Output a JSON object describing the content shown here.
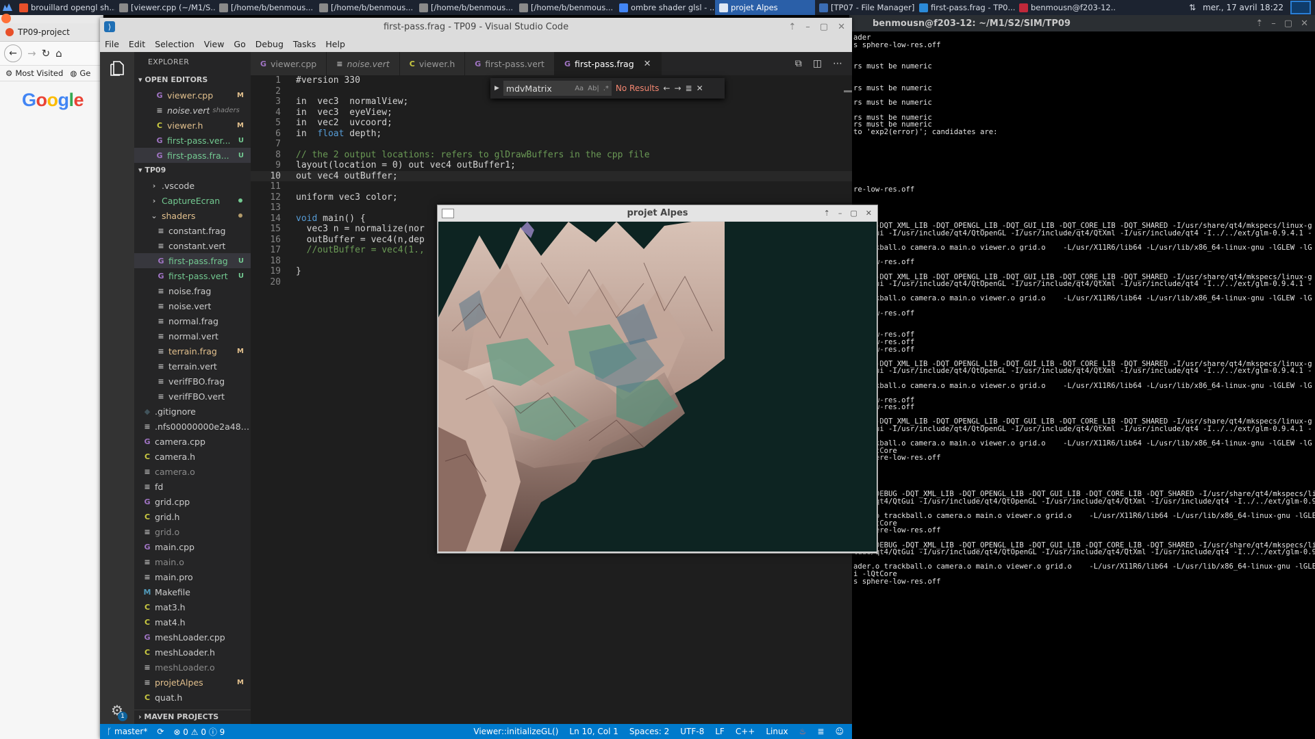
{
  "taskbar": {
    "tasks": [
      {
        "label": "brouillard opengl sh...",
        "icon": "firefox-icon",
        "color": "#e8502a"
      },
      {
        "label": "[viewer.cpp (~/M1/S...",
        "icon": "editor-icon",
        "color": "#8a8a8a"
      },
      {
        "label": "[/home/b/benmous...",
        "icon": "editor-icon",
        "color": "#8a8a8a"
      },
      {
        "label": "[/home/b/benmous...",
        "icon": "editor-icon",
        "color": "#8a8a8a"
      },
      {
        "label": "[/home/b/benmous...",
        "icon": "editor-icon",
        "color": "#8a8a8a"
      },
      {
        "label": "[/home/b/benmous...",
        "icon": "editor-icon",
        "color": "#8a8a8a"
      },
      {
        "label": "ombre shader glsl - ...",
        "icon": "chrome-icon",
        "color": "#4285f4"
      },
      {
        "label": "projet Alpes",
        "icon": "window-icon",
        "color": "#dfe8f5",
        "active": true
      },
      {
        "label": "[TP07 - File Manager]",
        "icon": "folder-icon",
        "color": "#3b6db5"
      },
      {
        "label": "first-pass.frag - TP0...",
        "icon": "vscode-icon",
        "color": "#2b8ad8"
      },
      {
        "label": "benmousn@f203-12...",
        "icon": "terminal-icon",
        "color": "#c0283a"
      }
    ],
    "clock": "mer., 17 avril 18:22"
  },
  "firefox": {
    "tab_title": "TP09-project",
    "bookmark": "Most Visited",
    "bookmark2": "Ge",
    "logo_text": "Google"
  },
  "terminal": {
    "title": "benmousn@f203-12: ~/M1/S2/SIM/TP09",
    "lines": [
      "ader",
      "s sphere-low-res.off",
      "",
      "",
      "rs must be numeric",
      "",
      "",
      "rs must be numeric",
      "",
      "rs must be numeric",
      "",
      "rs must be numeric",
      "rs must be numeric",
      "to 'exp2(error)'; candidates are:",
      "",
      "",
      "",
      "",
      "",
      "",
      "",
      "re-low-res.off",
      "",
      "",
      "",
      "",
      "EBUG -DQT_XML_LIB -DQT_OPENGL_LIB -DQT_GUI_LIB -DQT_CORE_LIB -DQT_SHARED -I/usr/share/qt4/mkspecs/linux-g",
      "4/QtGui -I/usr/include/qt4/QtOpenGL -I/usr/include/qt4/QtXml -I/usr/include/qt4 -I../../ext/glm-0.9.4.1 -",
      "",
      " trackball.o camera.o main.o viewer.o grid.o    -L/usr/X11R6/lib64 -L/usr/lib/x86_64-linux-gnu -lGLEW -lG",
      "Core",
      "re-low-res.off",
      "",
      "EBUG -DQT_XML_LIB -DQT_OPENGL_LIB -DQT_GUI_LIB -DQT_CORE_LIB -DQT_SHARED -I/usr/share/qt4/mkspecs/linux-g",
      "4/QtGui -I/usr/include/qt4/QtOpenGL -I/usr/include/qt4/QtXml -I/usr/include/qt4 -I../../ext/glm-0.9.4.1 -",
      "",
      " trackball.o camera.o main.o viewer.o grid.o    -L/usr/X11R6/lib64 -L/usr/lib/x86_64-linux-gnu -lGLEW -lG",
      "Core",
      "re-low-res.off",
      "",
      "",
      "re-low-res.off",
      "re-low-res.off",
      "re-low-res.off",
      "",
      "EBUG -DQT_XML_LIB -DQT_OPENGL_LIB -DQT_GUI_LIB -DQT_CORE_LIB -DQT_SHARED -I/usr/share/qt4/mkspecs/linux-g",
      "4/QtGui -I/usr/include/qt4/QtOpenGL -I/usr/include/qt4/QtXml -I/usr/include/qt4 -I../../ext/glm-0.9.4.1 -",
      "",
      " trackball.o camera.o main.o viewer.o grid.o    -L/usr/X11R6/lib64 -L/usr/lib/x86_64-linux-gnu -lGLEW -lG",
      "Core",
      "re-low-res.off",
      "re-low-res.off",
      "",
      "EBUG -DQT_XML_LIB -DQT_OPENGL_LIB -DQT_GUI_LIB -DQT_CORE_LIB -DQT_SHARED -I/usr/share/qt4/mkspecs/linux-g",
      "4/QtGui -I/usr/include/qt4/QtOpenGL -I/usr/include/qt4/QtXml -I/usr/include/qt4 -I../../ext/glm-0.9.4.1 -",
      "",
      " trackball.o camera.o main.o viewer.o grid.o    -L/usr/X11R6/lib64 -L/usr/lib/x86_64-linux-gnu -lGLEW -lG",
      "i -lQtCore",
      "s sphere-low-res.off",
      "",
      "",
      "",
      "",
      "T_NO_DEBUG -DQT_XML_LIB -DQT_OPENGL_LIB -DQT_GUI_LIB -DQT_CORE_LIB -DQT_SHARED -I/usr/share/qt4/mkspecs/linux-",
      "lude/qt4/QtGui -I/usr/include/qt4/QtOpenGL -I/usr/include/qt4/QtXml -I/usr/include/qt4 -I../../ext/glm-0.9.4.1 -",
      "",
      "ader.o trackball.o camera.o main.o viewer.o grid.o    -L/usr/X11R6/lib64 -L/usr/lib/x86_64-linux-gnu -lGLEW -lG",
      "i -lQtCore",
      "s sphere-low-res.off",
      "",
      "T_NO_DEBUG -DQT_XML_LIB -DQT_OPENGL_LIB -DQT_GUI_LIB -DQT_CORE_LIB -DQT_SHARED -I/usr/share/qt4/mkspecs/linux-",
      "lude/qt4/QtGui -I/usr/include/qt4/QtOpenGL -I/usr/include/qt4/QtXml -I/usr/include/qt4 -I../../ext/glm-0.9.4.1 -",
      "",
      "ader.o trackball.o camera.o main.o viewer.o grid.o    -L/usr/X11R6/lib64 -L/usr/lib/x86_64-linux-gnu -lGLEW -lG",
      "i -lQtCore",
      "s sphere-low-res.off"
    ]
  },
  "vscode": {
    "title": "first-pass.frag - TP09 - Visual Studio Code",
    "menu": [
      "File",
      "Edit",
      "Selection",
      "View",
      "Go",
      "Debug",
      "Tasks",
      "Help"
    ],
    "explorer_label": "EXPLORER",
    "open_editors_label": "OPEN EDITORS",
    "project_label": "TP09",
    "maven_label": "MAVEN PROJECTS",
    "open_editors": [
      {
        "name": "viewer.cpp",
        "icon": "G",
        "icolor": "#a074c4",
        "status": "M",
        "cls": "mod"
      },
      {
        "name": "noise.vert",
        "sub": "shaders",
        "icon": "≡",
        "icolor": "#bbbbbb",
        "italic": true
      },
      {
        "name": "viewer.h",
        "icon": "C",
        "icolor": "#cbcb41",
        "status": "M",
        "cls": "mod"
      },
      {
        "name": "first-pass.ver...",
        "icon": "G",
        "icolor": "#a074c4",
        "status": "U",
        "cls": "unt"
      },
      {
        "name": "first-pass.fra...",
        "icon": "G",
        "icolor": "#a074c4",
        "status": "U",
        "cls": "unt",
        "sel": true
      }
    ],
    "tree": [
      {
        "name": ".vscode",
        "icon": "›",
        "icolor": "#bbbbbb",
        "lvl": 1
      },
      {
        "name": "CaptureEcran",
        "icon": "›",
        "icolor": "#bbbbbb",
        "lvl": 1,
        "cls": "unt",
        "dot": "#73c991"
      },
      {
        "name": "shaders",
        "icon": "⌄",
        "icolor": "#bbbbbb",
        "lvl": 1,
        "cls": "mod",
        "dot": "#b39b6a"
      },
      {
        "name": "constant.frag",
        "icon": "≡",
        "icolor": "#bbbbbb",
        "lvl": 2
      },
      {
        "name": "constant.vert",
        "icon": "≡",
        "icolor": "#bbbbbb",
        "lvl": 2
      },
      {
        "name": "first-pass.frag",
        "icon": "G",
        "icolor": "#a074c4",
        "lvl": 2,
        "cls": "unt",
        "status": "U",
        "sel": true
      },
      {
        "name": "first-pass.vert",
        "icon": "G",
        "icolor": "#a074c4",
        "lvl": 2,
        "cls": "unt",
        "status": "U"
      },
      {
        "name": "noise.frag",
        "icon": "≡",
        "icolor": "#bbbbbb",
        "lvl": 2
      },
      {
        "name": "noise.vert",
        "icon": "≡",
        "icolor": "#bbbbbb",
        "lvl": 2
      },
      {
        "name": "normal.frag",
        "icon": "≡",
        "icolor": "#bbbbbb",
        "lvl": 2
      },
      {
        "name": "normal.vert",
        "icon": "≡",
        "icolor": "#bbbbbb",
        "lvl": 2
      },
      {
        "name": "terrain.frag",
        "icon": "≡",
        "icolor": "#bbbbbb",
        "lvl": 2,
        "cls": "mod",
        "status": "M"
      },
      {
        "name": "terrain.vert",
        "icon": "≡",
        "icolor": "#bbbbbb",
        "lvl": 2
      },
      {
        "name": "verifFBO.frag",
        "icon": "≡",
        "icolor": "#bbbbbb",
        "lvl": 2
      },
      {
        "name": "verifFBO.vert",
        "icon": "≡",
        "icolor": "#bbbbbb",
        "lvl": 2
      },
      {
        "name": ".gitignore",
        "icon": "◆",
        "icolor": "#41535b",
        "lvl": 0
      },
      {
        "name": ".nfs00000000e2a48c...",
        "icon": "≡",
        "icolor": "#bbbbbb",
        "lvl": 0
      },
      {
        "name": "camera.cpp",
        "icon": "G",
        "icolor": "#a074c4",
        "lvl": 0
      },
      {
        "name": "camera.h",
        "icon": "C",
        "icolor": "#cbcb41",
        "lvl": 0
      },
      {
        "name": "camera.o",
        "icon": "≡",
        "icolor": "#bbbbbb",
        "lvl": 0,
        "cls": "dim"
      },
      {
        "name": "fd",
        "icon": "≡",
        "icolor": "#bbbbbb",
        "lvl": 0
      },
      {
        "name": "grid.cpp",
        "icon": "G",
        "icolor": "#a074c4",
        "lvl": 0
      },
      {
        "name": "grid.h",
        "icon": "C",
        "icolor": "#cbcb41",
        "lvl": 0
      },
      {
        "name": "grid.o",
        "icon": "≡",
        "icolor": "#bbbbbb",
        "lvl": 0,
        "cls": "dim"
      },
      {
        "name": "main.cpp",
        "icon": "G",
        "icolor": "#a074c4",
        "lvl": 0
      },
      {
        "name": "main.o",
        "icon": "≡",
        "icolor": "#bbbbbb",
        "lvl": 0,
        "cls": "dim"
      },
      {
        "name": "main.pro",
        "icon": "≡",
        "icolor": "#bbbbbb",
        "lvl": 0
      },
      {
        "name": "Makefile",
        "icon": "M",
        "icolor": "#519aba",
        "lvl": 0
      },
      {
        "name": "mat3.h",
        "icon": "C",
        "icolor": "#cbcb41",
        "lvl": 0
      },
      {
        "name": "mat4.h",
        "icon": "C",
        "icolor": "#cbcb41",
        "lvl": 0
      },
      {
        "name": "meshLoader.cpp",
        "icon": "G",
        "icolor": "#a074c4",
        "lvl": 0
      },
      {
        "name": "meshLoader.h",
        "icon": "C",
        "icolor": "#cbcb41",
        "lvl": 0
      },
      {
        "name": "meshLoader.o",
        "icon": "≡",
        "icolor": "#bbbbbb",
        "lvl": 0,
        "cls": "dim"
      },
      {
        "name": "projetAlpes",
        "icon": "≡",
        "icolor": "#bbbbbb",
        "lvl": 0,
        "cls": "mod",
        "status": "M"
      },
      {
        "name": "quat.h",
        "icon": "C",
        "icolor": "#cbcb41",
        "lvl": 0
      }
    ],
    "tabs": [
      {
        "label": "viewer.cpp",
        "icon": "G",
        "icolor": "#a074c4"
      },
      {
        "label": "noise.vert",
        "icon": "≡",
        "icolor": "#bbbbbb",
        "italic": true
      },
      {
        "label": "viewer.h",
        "icon": "C",
        "icolor": "#cbcb41"
      },
      {
        "label": "first-pass.vert",
        "icon": "G",
        "icolor": "#a074c4"
      },
      {
        "label": "first-pass.frag",
        "icon": "G",
        "icolor": "#a074c4",
        "active": true
      }
    ],
    "code": [
      [
        [
          "#version 330",
          "tp"
        ]
      ],
      [
        [
          "",
          "tp"
        ]
      ],
      [
        [
          "in  vec3  normalView;",
          "tp"
        ]
      ],
      [
        [
          "in  vec3  eyeView;",
          "tp"
        ]
      ],
      [
        [
          "in  vec2  uvcoord;",
          "tp"
        ]
      ],
      [
        [
          "in  ",
          "tp"
        ],
        [
          "float",
          "kw"
        ],
        [
          " depth;",
          "tp"
        ]
      ],
      [
        [
          "",
          "tp"
        ]
      ],
      [
        [
          "// the 2 output locations: refers to glDrawBuffers in the cpp file",
          "cm"
        ]
      ],
      [
        [
          "layout(location = 0) out vec4 outBuffer1;",
          "tp"
        ]
      ],
      [
        [
          "out vec4 outBuffer;",
          "tp"
        ]
      ],
      [
        [
          "",
          "tp"
        ]
      ],
      [
        [
          "uniform vec3 color;",
          "tp"
        ]
      ],
      [
        [
          "",
          "tp"
        ]
      ],
      [
        [
          "void",
          "kw"
        ],
        [
          " main() {",
          "tp"
        ]
      ],
      [
        [
          "  vec3 n = normalize(nor",
          "tp"
        ]
      ],
      [
        [
          "  outBuffer = vec4(n,dep",
          "tp"
        ]
      ],
      [
        [
          "  //outBuffer = vec4(1.,",
          "cm"
        ]
      ],
      [
        [
          "",
          "tp"
        ]
      ],
      [
        [
          "}",
          "tp"
        ]
      ],
      [
        [
          "",
          "tp"
        ]
      ]
    ],
    "current_line": 10,
    "find": {
      "query": "mdvMatrix",
      "opt1": "Aa",
      "opt2": "Ab|",
      "opt3": ".*",
      "result": "No Results"
    },
    "status": {
      "branch": "master*",
      "errors": "0",
      "warnings": "0",
      "infos": "9",
      "function": "Viewer::initializeGL()",
      "position": "Ln 10, Col 1",
      "spaces": "Spaces: 2",
      "encoding": "UTF-8",
      "eol": "LF",
      "language": "C++",
      "os": "Linux"
    },
    "badge": "1"
  },
  "alpes_window": {
    "title": "projet Alpes",
    "sky_color": "#0d2422"
  },
  "colors": {
    "taskbar": "#1c2330",
    "vscode_status": "#007acc",
    "accent_active_task": "#2a5fa8"
  }
}
